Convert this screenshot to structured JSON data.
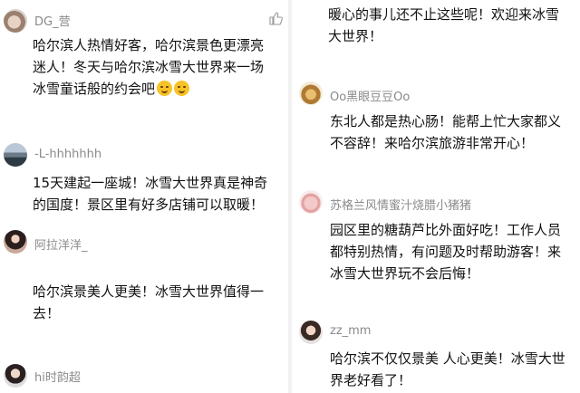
{
  "left": {
    "comments": [
      {
        "username": "DG_营",
        "lines": [
          "哈尔滨人热情好客，哈尔滨景色更漂亮",
          "迷人！冬天与哈尔滨冰雪大世界来一场",
          "冰雪童话般的约会吧"
        ],
        "emoji_count": 2,
        "avatar": "cat-avatar"
      },
      {
        "username": "-L-hhhhhhh",
        "lines": [
          "15天建起一座城！冰雪大世界真是神奇",
          "的国度！景区里有好多店铺可以取暖！"
        ],
        "avatar": "landscape-avatar"
      },
      {
        "username": "阿拉洋洋_",
        "lines": [
          "哈尔滨景美人更美！冰雪大世界值得一",
          "去！"
        ],
        "avatar": "girl-avatar"
      },
      {
        "username": "hi时韵超",
        "lines": [],
        "avatar": "portrait-avatar"
      }
    ]
  },
  "right": {
    "top_continuation": [
      "暖心的事儿还不止这些呢！欢迎来冰雪",
      "大世界！"
    ],
    "comments": [
      {
        "username": "Oo黑眼豆豆Oo",
        "lines": [
          "东北人都是热心肠！能帮上忙大家都义",
          "不容辞！来哈尔滨旅游非常开心！"
        ],
        "avatar": "dog-avatar"
      },
      {
        "username": "苏格兰风情蜜汁烧腊小猪猪",
        "lines": [
          "园区里的糖葫芦比外面好吃！工作人员",
          "都特别热情，有问题及时帮助游客！来",
          "冰雪大世界玩不会后悔！"
        ],
        "avatar": "pig-avatar"
      },
      {
        "username": "zz_mm",
        "lines": [
          "哈尔滨不仅仅景美  人心更美！冰雪大世",
          "界老好看了！"
        ],
        "avatar": "person-avatar"
      }
    ]
  },
  "colors": {
    "username": "#8a8a8a",
    "text": "#111111",
    "divider": "#f1f1f1"
  }
}
